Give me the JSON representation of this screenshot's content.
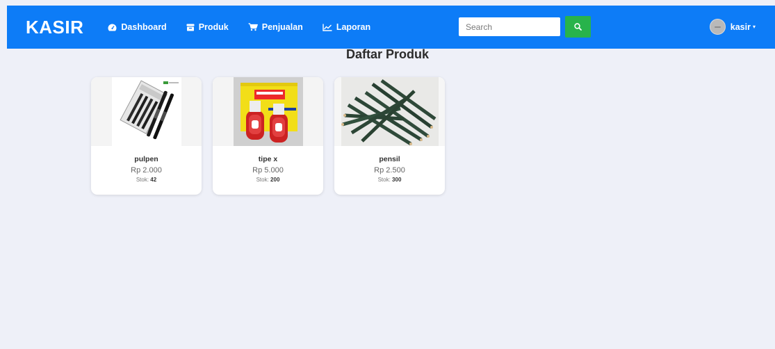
{
  "brand": "KASIR",
  "nav": [
    {
      "label": "Dashboard",
      "icon": "dashboard-icon"
    },
    {
      "label": "Produk",
      "icon": "box-icon"
    },
    {
      "label": "Penjualan",
      "icon": "cart-icon"
    },
    {
      "label": "Laporan",
      "icon": "chart-line-icon"
    }
  ],
  "search": {
    "placeholder": "Search",
    "button_icon": "search-icon"
  },
  "user": {
    "name": "kasir",
    "avatar_icon": "avatar-icon"
  },
  "page": {
    "title": "Daftar Produk"
  },
  "stock_label": "Stok:",
  "products": [
    {
      "name": "pulpen",
      "price": "Rp 2.000",
      "stock": "42",
      "image": "pens-image"
    },
    {
      "name": "tipe x",
      "price": "Rp 5.000",
      "stock": "200",
      "image": "correction-fluid-image"
    },
    {
      "name": "pensil",
      "price": "Rp 2.500",
      "stock": "300",
      "image": "pencils-image"
    }
  ],
  "colors": {
    "navbar": "#0d7cf7",
    "search_button": "#28b34b",
    "background": "#eef0f8"
  }
}
